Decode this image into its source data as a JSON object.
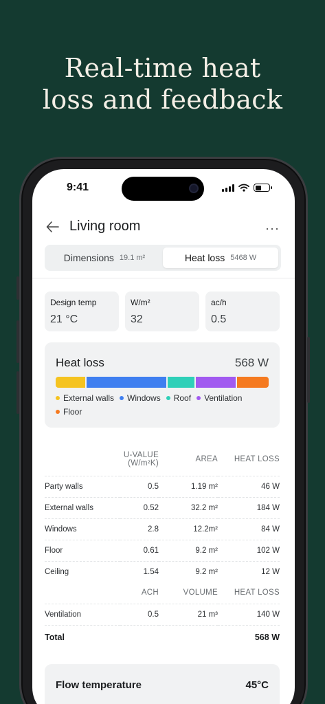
{
  "headline": {
    "line1": "Real-time heat",
    "line2": "loss and feedback"
  },
  "status_bar": {
    "time": "9:41"
  },
  "nav": {
    "title": "Living room",
    "more": "···",
    "back_icon": "arrow-left-icon"
  },
  "segments": [
    {
      "label": "Dimensions",
      "sub": "19.1 m²",
      "active": false
    },
    {
      "label": "Heat loss",
      "sub": "5468 W",
      "active": true
    }
  ],
  "stats": [
    {
      "label": "Design temp",
      "value": "21 °C"
    },
    {
      "label": "W/m²",
      "value": "32"
    },
    {
      "label": "ac/h",
      "value": "0.5"
    }
  ],
  "heat_loss_card": {
    "title": "Heat loss",
    "total": "568 W",
    "breakdown": [
      {
        "name": "External walls",
        "color": "#f5c320",
        "share": 0.14
      },
      {
        "name": "Windows",
        "color": "#3f7ff0",
        "share": 0.38
      },
      {
        "name": "Roof",
        "color": "#2fd0b8",
        "share": 0.13
      },
      {
        "name": "Ventilation",
        "color": "#a15af0",
        "share": 0.19
      },
      {
        "name": "Floor",
        "color": "#f57a20",
        "share": 0.15
      }
    ]
  },
  "fabric_table": {
    "headers": {
      "u_value": "U-VALUE",
      "u_unit": "(W/m²K)",
      "area": "AREA",
      "heat_loss": "HEAT LOSS"
    },
    "rows": [
      {
        "element": "Party walls",
        "u": "0.5",
        "area": "1.19 m²",
        "loss": "46 W"
      },
      {
        "element": "External walls",
        "u": "0.52",
        "area": "32.2 m²",
        "loss": "184 W"
      },
      {
        "element": "Windows",
        "u": "2.8",
        "area": "12.2m²",
        "loss": "84 W"
      },
      {
        "element": "Floor",
        "u": "0.61",
        "area": "9.2 m²",
        "loss": "102 W"
      },
      {
        "element": "Ceiling",
        "u": "1.54",
        "area": "9.2 m²",
        "loss": "12 W"
      }
    ],
    "vent_headers": {
      "ach": "ACH",
      "volume": "VOLUME",
      "heat_loss": "HEAT LOSS"
    },
    "vent_row": {
      "element": "Ventilation",
      "ach": "0.5",
      "volume": "21 m³",
      "loss": "140 W"
    },
    "total": {
      "label": "Total",
      "value": "568 W"
    }
  },
  "flow_card": {
    "title": "Flow temperature",
    "value": "45°C"
  }
}
